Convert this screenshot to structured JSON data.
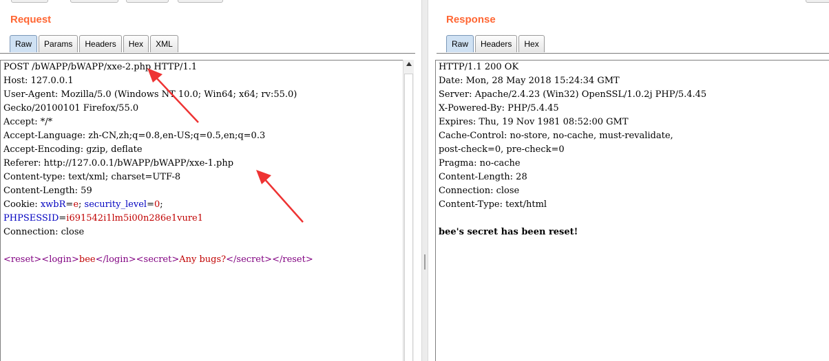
{
  "request": {
    "title": "Request",
    "tabs": [
      "Raw",
      "Params",
      "Headers",
      "Hex",
      "XML"
    ],
    "active_tab": "Raw",
    "lines": [
      "POST /bWAPP/bWAPP/xxe-2.php HTTP/1.1",
      "Host: 127.0.0.1",
      "User-Agent: Mozilla/5.0 (Windows NT 10.0; Win64; x64; rv:55.0)",
      "Gecko/20100101 Firefox/55.0",
      "Accept: */*",
      "Accept-Language: zh-CN,zh;q=0.8,en-US;q=0.5,en;q=0.3",
      "Accept-Encoding: gzip, deflate",
      "Referer: http://127.0.0.1/bWAPP/bWAPP/xxe-1.php",
      "Content-type: text/xml; charset=UTF-8",
      "Content-Length: 59"
    ],
    "cookie": {
      "prefix": "Cookie: ",
      "name1": "xwbR",
      "value1": "e",
      "sep": "; ",
      "name2": "security_level",
      "value2": "0",
      "end": ";",
      "name3": "PHPSESSID",
      "value3": "i691542i1lm5i00n286e1vure1"
    },
    "connection": "Connection: close",
    "body": {
      "open_reset": "<reset>",
      "open_login": "<login>",
      "login_value": "bee",
      "close_login": "</login>",
      "open_secret": "<secret>",
      "secret_value": "Any bugs?",
      "close_secret": "</secret>",
      "close_reset": "</reset>"
    }
  },
  "response": {
    "title": "Response",
    "tabs": [
      "Raw",
      "Headers",
      "Hex"
    ],
    "active_tab": "Raw",
    "lines": [
      "HTTP/1.1 200 OK",
      "Date: Mon, 28 May 2018 15:24:34 GMT",
      "Server: Apache/2.4.23 (Win32) OpenSSL/1.0.2j PHP/5.4.45",
      "X-Powered-By: PHP/5.4.45",
      "Expires: Thu, 19 Nov 1981 08:52:00 GMT",
      "Cache-Control: no-store, no-cache, must-revalidate,",
      "post-check=0, pre-check=0",
      "Pragma: no-cache",
      "Content-Length: 28",
      "Connection: close",
      "Content-Type: text/html"
    ],
    "body": "bee's secret has been reset!"
  },
  "colors": {
    "title": "#ff6633",
    "active_tab": "#cfe1f3",
    "cookie_name": "#0000c0",
    "cookie_value": "#c00000",
    "annotation_arrow": "#ee3333"
  }
}
